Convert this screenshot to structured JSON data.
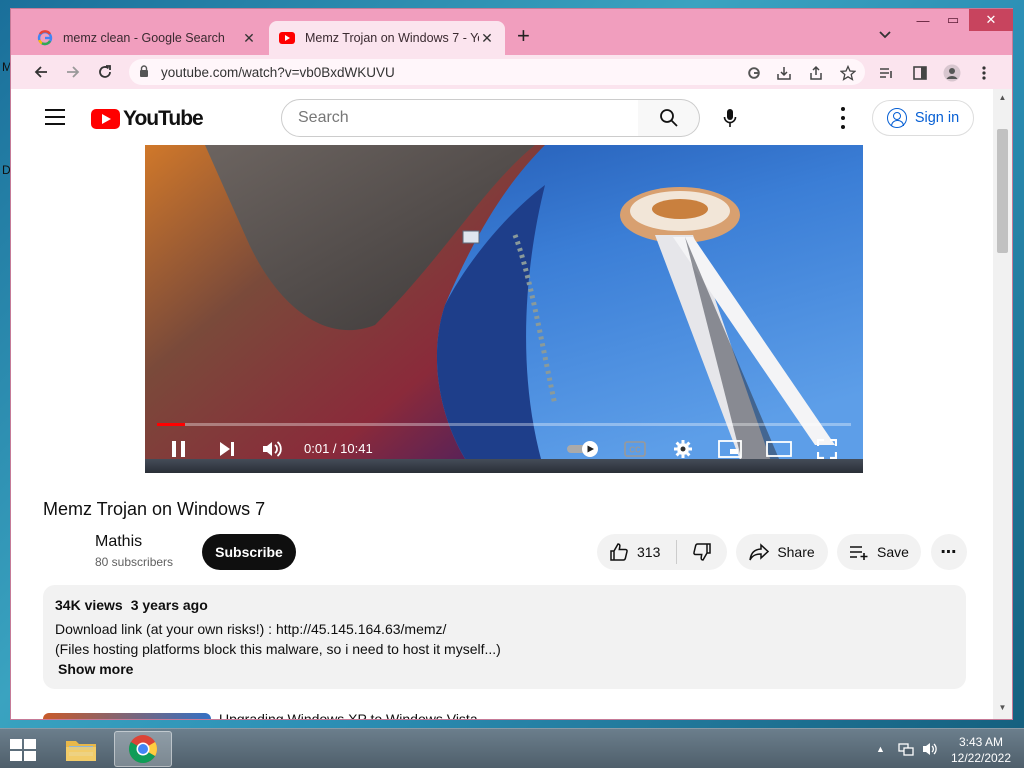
{
  "desktop": {
    "left_letters": [
      "M",
      "D"
    ]
  },
  "browser": {
    "tabs": [
      {
        "title": "memz clean - Google Search",
        "favicon": "google-g-icon",
        "active": false
      },
      {
        "title": "Memz Trojan on Windows 7 - Yo",
        "favicon": "youtube-icon",
        "active": true
      }
    ],
    "url": "youtube.com/watch?v=vb0BxdWKUVU",
    "window_controls": {
      "minimize": "—",
      "maximize": "▭",
      "close": "✕"
    }
  },
  "youtube": {
    "logo_text": "YouTube",
    "search_placeholder": "Search",
    "sign_in": "Sign in",
    "player": {
      "time": "0:01 / 10:41",
      "progress_fraction": 0.04
    },
    "video": {
      "title": "Memz Trojan on Windows 7",
      "channel": "Mathis",
      "subscribers": "80 subscribers",
      "subscribe_label": "Subscribe",
      "likes": "313",
      "share_label": "Share",
      "save_label": "Save"
    },
    "description": {
      "views": "34K views",
      "age": "3 years ago",
      "lines": [
        "Download link (at your own risks!) : http://45.145.164.63/memz/",
        "(Files hosting platforms block this malware, so i need to host it myself...)"
      ],
      "show_more": "Show more"
    },
    "next_up_title": "Upgrading Windows XP to Windows Vista"
  },
  "taskbar": {
    "time": "3:43 AM",
    "date": "12/22/2022"
  },
  "colors": {
    "window_frame": "#f19ebe",
    "yt_red": "#ff0000",
    "link_blue": "#065fd4"
  }
}
